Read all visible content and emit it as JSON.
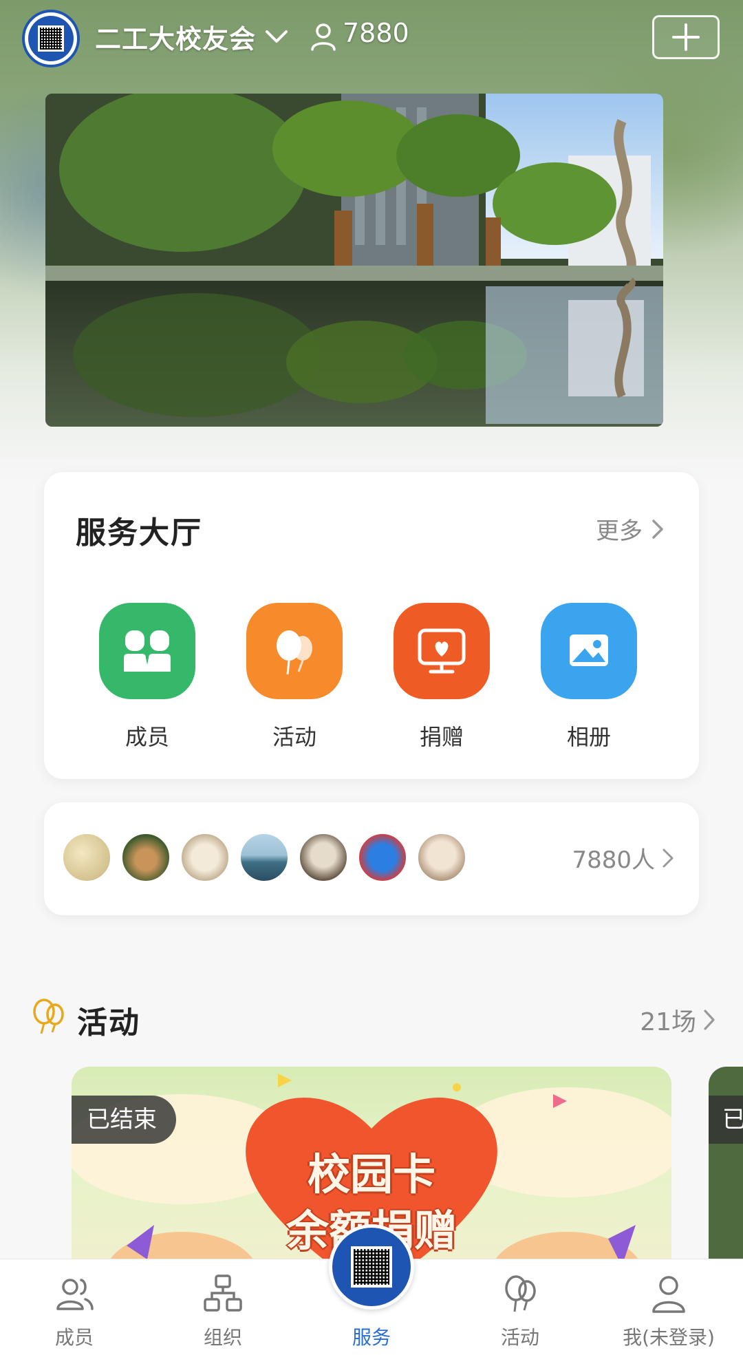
{
  "header": {
    "org_name": "二工大校友会",
    "member_count": "7880"
  },
  "service_hall": {
    "title": "服务大厅",
    "more_label": "更多",
    "items": [
      {
        "label": "成员",
        "icon": "members-icon",
        "color": "#35b86a"
      },
      {
        "label": "活动",
        "icon": "balloons-icon",
        "color": "#f78a2a"
      },
      {
        "label": "捐赠",
        "icon": "donation-screen-icon",
        "color": "#ee5b24"
      },
      {
        "label": "相册",
        "icon": "photo-album-icon",
        "color": "#3ba4ee"
      }
    ]
  },
  "members_strip": {
    "count_label": "7880人"
  },
  "activity": {
    "title": "活动",
    "count_label": "21场",
    "cards": [
      {
        "status": "已结束",
        "line1": "校园卡",
        "line2": "余额捐赠"
      },
      {
        "status": "已"
      }
    ]
  },
  "tabbar": {
    "tabs": [
      {
        "label": "成员",
        "icon": "members-outline-icon"
      },
      {
        "label": "组织",
        "icon": "org-chart-icon"
      },
      {
        "label": "服务",
        "icon": "qr-badge-icon"
      },
      {
        "label": "活动",
        "icon": "balloons-outline-icon"
      },
      {
        "label": "我(未登录)",
        "icon": "user-outline-icon"
      }
    ],
    "active_index": 2,
    "active_color": "#2a6fd6"
  }
}
